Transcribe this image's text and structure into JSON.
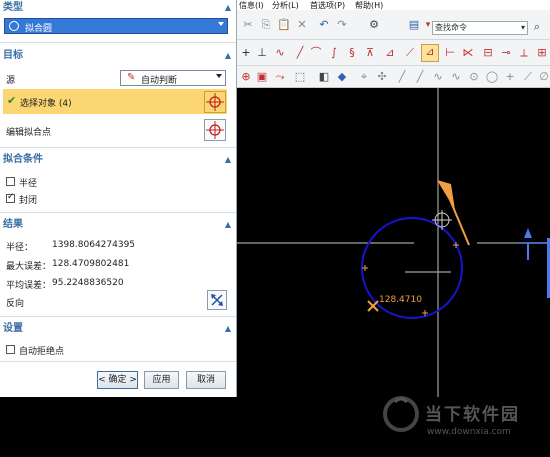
{
  "dialog": {
    "type_section": {
      "title": "类型",
      "selected": "拟合圆"
    },
    "target_section": {
      "title": "目标",
      "source_label": "源",
      "source_value": "自动判断",
      "select_objects": "选择对象 (4)",
      "edit_points": "编辑拟合点"
    },
    "conditions_section": {
      "title": "拟合条件",
      "radius_label": "半径",
      "radius_checked": false,
      "closed_label": "封闭",
      "closed_checked": true
    },
    "result_section": {
      "title": "结果",
      "radius_label": "半径：",
      "radius_value": "1398.8064274395",
      "max_error_label": "最大误差：",
      "max_error_value": "128.4709802481",
      "avg_error_label": "平均误差：",
      "avg_error_value": "95.2248836520",
      "reverse_label": "反向"
    },
    "settings_section": {
      "title": "设置",
      "auto_remove_label": "自动拒绝点",
      "auto_remove_checked": false
    },
    "buttons": {
      "ok": "< 确定 >",
      "apply": "应用",
      "cancel": "取消"
    }
  },
  "menubar": {
    "items": [
      "信息(I)",
      "分析(L)",
      "首选项(P)",
      "帮助(H)"
    ]
  },
  "toolbar": {
    "search_placeholder": "查找命令"
  },
  "canvas": {
    "max_error_label": "128.4710"
  },
  "watermark": {
    "brand": "当下软件园",
    "url": "www.downxia.com"
  },
  "colors": {
    "accent": "#3a6ea5",
    "highlight_row": "#fbd672",
    "circle": "#1515cc",
    "orange": "#f0a040",
    "axis": "#a0a0a0"
  }
}
